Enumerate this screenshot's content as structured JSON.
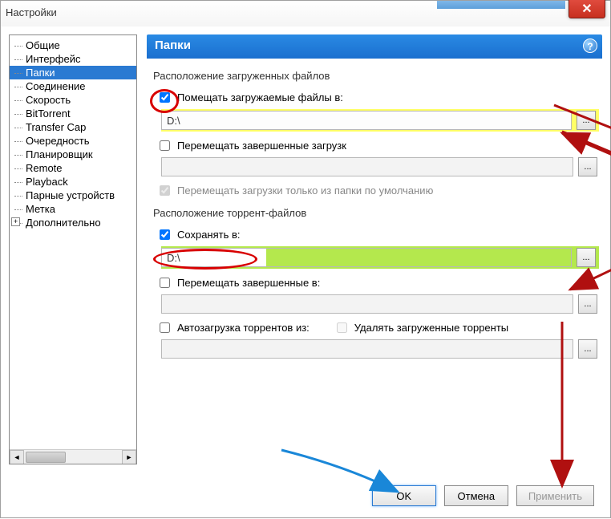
{
  "window": {
    "title": "Настройки"
  },
  "tree": {
    "items": [
      "Общие",
      "Интерфейс",
      "Папки",
      "Соединение",
      "Скорость",
      "BitTorrent",
      "Transfer Cap",
      "Очередность",
      "Планировщик",
      "Remote",
      "Playback",
      "Парные устройств",
      "Метка",
      "Дополнительно"
    ],
    "selected_index": 2,
    "expandable_index": 13
  },
  "panel": {
    "title": "Папки"
  },
  "group1": {
    "title": "Расположение загруженных файлов",
    "chk1_label": "Помещать загружаемые файлы в:",
    "chk1_checked": true,
    "path1": "D:\\",
    "chk2_label": "Перемещать завершенные загрузк",
    "chk2_checked": false,
    "path2": "",
    "chk3_label": "Перемещать загрузки только из папки по умолчанию",
    "chk3_checked": true
  },
  "group2": {
    "title": "Расположение торрент-файлов",
    "chk1_label": "Сохранять в:",
    "chk1_checked": true,
    "path1": "D:\\",
    "chk2_label": "Перемещать завершенные в:",
    "chk2_checked": false,
    "path2": "",
    "chk3_label": "Автозагрузка торрентов из:",
    "chk3_checked": false,
    "chk4_label": "Удалять загруженные торренты",
    "chk4_checked": false,
    "path3": ""
  },
  "buttons": {
    "ok": "OK",
    "cancel": "Отмена",
    "apply": "Применить"
  },
  "browse_label": "..."
}
